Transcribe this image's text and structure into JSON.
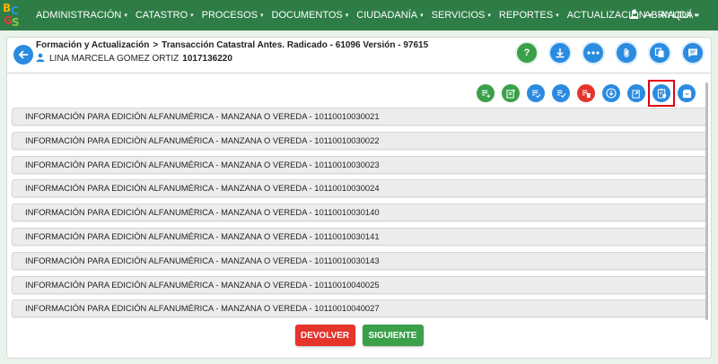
{
  "logo": {
    "letters": [
      "B",
      "C",
      "G",
      "S"
    ],
    "colors": [
      "#f4b400",
      "#2196f3",
      "#e53935",
      "#8bc34a"
    ]
  },
  "nav": {
    "items": [
      {
        "label": "ADMINISTRACIÓN"
      },
      {
        "label": "CATASTRO"
      },
      {
        "label": "PROCESOS"
      },
      {
        "label": "DOCUMENTOS"
      },
      {
        "label": "CIUDADANÍA"
      },
      {
        "label": "SERVICIOS"
      },
      {
        "label": "REPORTES"
      },
      {
        "label": "ACTUALIZACIÓN"
      },
      {
        "label": "AYUDA"
      }
    ],
    "caret": "▾",
    "user": {
      "icon": "user-icon",
      "name": "ABRIAQUÍ",
      "caret": "▾"
    }
  },
  "header": {
    "breadcrumb_1": "Formación y Actualización",
    "breadcrumb_sep": ">",
    "breadcrumb_2": "Transacción Catastral Antes. Radicado - 61096 Versión - 97615",
    "user_name": "LINA MARCELA GOMEZ ORTIZ",
    "user_doc": "1017136220",
    "actions": [
      "help-icon",
      "download-icon",
      "more-icon",
      "attachment-icon",
      "copy-icon",
      "comment-icon"
    ]
  },
  "toolbar": {
    "buttons": [
      {
        "icon": "add-list-icon",
        "color": "green"
      },
      {
        "icon": "edit-note-icon",
        "color": "green"
      },
      {
        "icon": "list-check-icon",
        "color": "blue"
      },
      {
        "icon": "list-done-icon",
        "color": "blue"
      },
      {
        "icon": "delete-list-icon",
        "color": "red"
      },
      {
        "icon": "download-circle-icon",
        "color": "blue"
      },
      {
        "icon": "export-icon",
        "color": "blue"
      },
      {
        "icon": "clipboard-settings-icon",
        "color": "blue",
        "highlighted": true
      },
      {
        "icon": "archive-icon",
        "color": "blue"
      }
    ]
  },
  "rows": [
    "INFORMACIÓN PARA EDICIÓN ALFANUMÉRICA - MANZANA O VEREDA - 10110010030021",
    "INFORMACIÓN PARA EDICIÓN ALFANUMÉRICA - MANZANA O VEREDA - 10110010030022",
    "INFORMACIÓN PARA EDICIÓN ALFANUMÉRICA - MANZANA O VEREDA - 10110010030023",
    "INFORMACIÓN PARA EDICIÓN ALFANUMÉRICA - MANZANA O VEREDA - 10110010030024",
    "INFORMACIÓN PARA EDICIÓN ALFANUMÉRICA - MANZANA O VEREDA - 10110010030140",
    "INFORMACIÓN PARA EDICIÓN ALFANUMÉRICA - MANZANA O VEREDA - 10110010030141",
    "INFORMACIÓN PARA EDICIÓN ALFANUMÉRICA - MANZANA O VEREDA - 10110010030143",
    "INFORMACIÓN PARA EDICIÓN ALFANUMÉRICA - MANZANA O VEREDA - 10110010040025",
    "INFORMACIÓN PARA EDICIÓN ALFANUMÉRICA - MANZANA O VEREDA - 10110010040027"
  ],
  "footer": {
    "return_label": "DEVOLVER",
    "next_label": "SIGUIENTE"
  }
}
